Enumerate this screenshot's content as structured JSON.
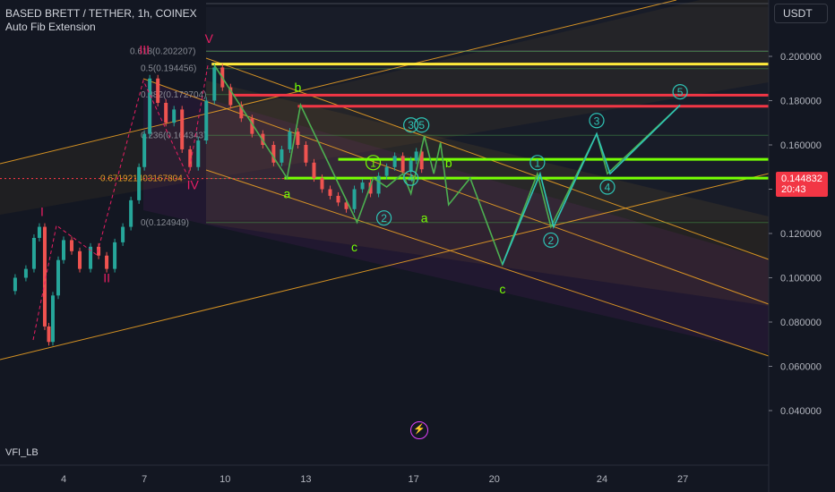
{
  "header": {
    "title": "BASED BRETT / TETHER, 1h, COINEX",
    "indicator": "Auto Fib Extension"
  },
  "currency": "USDT",
  "indicator_pane": {
    "label": "VFI_LB"
  },
  "last_price": {
    "value": "0.144832",
    "countdown": "20:43"
  },
  "colors": {
    "background": "#131722",
    "price_line": "#f23645",
    "candle_up": "#26a69a",
    "candle_down": "#ef5350",
    "channel": "#f5a623",
    "wave_green": "#4caf50",
    "wave_projection": "#2ec4b6",
    "fib_yellow": "#ffeb3b",
    "fib_red": "#f23645",
    "wave_pink": "#e91e63"
  },
  "chart_data": {
    "type": "line",
    "title": "BASED BRETT / TETHER, 1h, COINEX",
    "y_axis": {
      "ticks": [
        "0.200000",
        "0.180000",
        "0.160000",
        "0.140000",
        "0.120000",
        "0.100000",
        "0.080000",
        "0.060000",
        "0.040000"
      ],
      "range": [
        0.028,
        0.222
      ]
    },
    "x_axis": {
      "ticks": [
        "4",
        "7",
        "10",
        "13",
        "17",
        "20",
        "24",
        "27"
      ]
    },
    "price_series": [
      {
        "x": 1.8,
        "y": 0.094
      },
      {
        "x": 2.2,
        "y": 0.1
      },
      {
        "x": 2.6,
        "y": 0.104
      },
      {
        "x": 2.9,
        "y": 0.118
      },
      {
        "x": 3.1,
        "y": 0.123
      },
      {
        "x": 3.3,
        "y": 0.078
      },
      {
        "x": 3.45,
        "y": 0.071
      },
      {
        "x": 3.6,
        "y": 0.092
      },
      {
        "x": 3.8,
        "y": 0.108
      },
      {
        "x": 4.0,
        "y": 0.117
      },
      {
        "x": 4.3,
        "y": 0.112
      },
      {
        "x": 4.6,
        "y": 0.104
      },
      {
        "x": 5.0,
        "y": 0.114
      },
      {
        "x": 5.3,
        "y": 0.11
      },
      {
        "x": 5.6,
        "y": 0.104
      },
      {
        "x": 5.9,
        "y": 0.116
      },
      {
        "x": 6.2,
        "y": 0.123
      },
      {
        "x": 6.5,
        "y": 0.135
      },
      {
        "x": 6.8,
        "y": 0.15
      },
      {
        "x": 7.0,
        "y": 0.165
      },
      {
        "x": 7.2,
        "y": 0.19
      },
      {
        "x": 7.5,
        "y": 0.179
      },
      {
        "x": 7.8,
        "y": 0.17
      },
      {
        "x": 8.1,
        "y": 0.176
      },
      {
        "x": 8.4,
        "y": 0.158
      },
      {
        "x": 8.7,
        "y": 0.15
      },
      {
        "x": 9.0,
        "y": 0.162
      },
      {
        "x": 9.3,
        "y": 0.18
      },
      {
        "x": 9.6,
        "y": 0.195
      },
      {
        "x": 9.9,
        "y": 0.186
      },
      {
        "x": 10.2,
        "y": 0.178
      },
      {
        "x": 10.6,
        "y": 0.172
      },
      {
        "x": 11.0,
        "y": 0.165
      },
      {
        "x": 11.4,
        "y": 0.16
      },
      {
        "x": 11.8,
        "y": 0.152
      },
      {
        "x": 12.1,
        "y": 0.158
      },
      {
        "x": 12.4,
        "y": 0.166
      },
      {
        "x": 12.7,
        "y": 0.16
      },
      {
        "x": 13.0,
        "y": 0.152
      },
      {
        "x": 13.3,
        "y": 0.145
      },
      {
        "x": 13.6,
        "y": 0.14
      },
      {
        "x": 13.9,
        "y": 0.137
      },
      {
        "x": 14.2,
        "y": 0.134
      },
      {
        "x": 14.5,
        "y": 0.131
      },
      {
        "x": 14.8,
        "y": 0.14
      },
      {
        "x": 15.1,
        "y": 0.143
      },
      {
        "x": 15.4,
        "y": 0.138
      },
      {
        "x": 15.7,
        "y": 0.146
      },
      {
        "x": 16.0,
        "y": 0.15
      },
      {
        "x": 16.3,
        "y": 0.155
      },
      {
        "x": 16.6,
        "y": 0.148
      },
      {
        "x": 16.9,
        "y": 0.153
      },
      {
        "x": 17.1,
        "y": 0.157
      },
      {
        "x": 17.3,
        "y": 0.149
      }
    ],
    "series": [
      {
        "role": "primary_count",
        "points": [
          {
            "x": 9.6,
            "y": 0.196
          },
          {
            "x": 12.3,
            "y": 0.145
          },
          {
            "x": 12.8,
            "y": 0.178
          },
          {
            "x": 14.9,
            "y": 0.125
          },
          {
            "x": 15.5,
            "y": 0.145
          },
          {
            "x": 16.0,
            "y": 0.141
          },
          {
            "x": 16.6,
            "y": 0.147
          },
          {
            "x": 16.9,
            "y": 0.138
          },
          {
            "x": 17.4,
            "y": 0.164
          },
          {
            "x": 17.75,
            "y": 0.147
          },
          {
            "x": 18.0,
            "y": 0.161
          },
          {
            "x": 18.3,
            "y": 0.133
          },
          {
            "x": 19.1,
            "y": 0.145
          },
          {
            "x": 20.3,
            "y": 0.106
          },
          {
            "x": 21.6,
            "y": 0.147
          },
          {
            "x": 22.1,
            "y": 0.123
          },
          {
            "x": 23.8,
            "y": 0.165
          },
          {
            "x": 24.2,
            "y": 0.147
          },
          {
            "x": 26.9,
            "y": 0.178
          }
        ]
      },
      {
        "role": "projection",
        "points": [
          {
            "x": 20.3,
            "y": 0.106
          },
          {
            "x": 21.7,
            "y": 0.147
          },
          {
            "x": 22.2,
            "y": 0.123
          },
          {
            "x": 23.8,
            "y": 0.165
          },
          {
            "x": 24.3,
            "y": 0.147
          },
          {
            "x": 26.9,
            "y": 0.178
          }
        ]
      }
    ],
    "fib_levels": [
      {
        "label": "0.618(0.202207)",
        "y": 0.202207
      },
      {
        "label": "0.5(0.194456)",
        "y": 0.194456
      },
      {
        "label": "0.382(0.172704)",
        "y": 0.182704
      },
      {
        "label": "0.236(0.164343)",
        "y": 0.164343
      },
      {
        "label": "0.671921403167804(",
        "y": 0.14483
      },
      {
        "label": "0(0.124949)",
        "y": 0.124949
      }
    ],
    "horizontal_levels": [
      {
        "y": 0.1965,
        "color": "#ffeb3b",
        "x_from": 9.5
      },
      {
        "y": 0.1825,
        "color": "#f23645",
        "x_from": 10.3
      },
      {
        "y": 0.1775,
        "color": "#f23645",
        "x_from": 12.7
      },
      {
        "y": 0.1535,
        "color": "#76ff03",
        "x_from": 14.2
      },
      {
        "y": 0.145,
        "color": "#76ff03",
        "x_from": 12.2
      }
    ],
    "wave_labels": [
      {
        "text": "I",
        "x": 3.2,
        "y": 0.13,
        "color": "#e91e63"
      },
      {
        "text": "II",
        "x": 5.6,
        "y": 0.1,
        "color": "#e91e63"
      },
      {
        "text": "III",
        "x": 7.0,
        "y": 0.203,
        "color": "#e91e63"
      },
      {
        "text": "IV",
        "x": 8.8,
        "y": 0.142,
        "color": "#e91e63"
      },
      {
        "text": "V",
        "x": 9.4,
        "y": 0.208,
        "color": "#e91e63"
      },
      {
        "text": "a",
        "x": 12.3,
        "y": 0.138,
        "color": "#76ff03"
      },
      {
        "text": "b",
        "x": 12.7,
        "y": 0.186,
        "color": "#76ff03"
      },
      {
        "text": "c",
        "x": 14.8,
        "y": 0.114,
        "color": "#76ff03"
      },
      {
        "text": "1",
        "x": 15.5,
        "y": 0.152,
        "color": "#76ff03",
        "circled": true
      },
      {
        "text": "2",
        "x": 15.9,
        "y": 0.127,
        "color": "#2ec4b6",
        "circled": true
      },
      {
        "text": "3",
        "x": 16.9,
        "y": 0.169,
        "color": "#2ec4b6",
        "circled": true
      },
      {
        "text": "4",
        "x": 16.9,
        "y": 0.145,
        "color": "#2ec4b6",
        "circled": true
      },
      {
        "text": "5",
        "x": 17.3,
        "y": 0.169,
        "color": "#2ec4b6",
        "circled": true
      },
      {
        "text": "a",
        "x": 17.4,
        "y": 0.127,
        "color": "#76ff03"
      },
      {
        "text": "b",
        "x": 18.3,
        "y": 0.152,
        "color": "#76ff03"
      },
      {
        "text": "c",
        "x": 20.3,
        "y": 0.095,
        "color": "#76ff03"
      },
      {
        "text": "1",
        "x": 21.6,
        "y": 0.152,
        "color": "#2ec4b6",
        "circled": true
      },
      {
        "text": "2",
        "x": 22.1,
        "y": 0.117,
        "color": "#2ec4b6",
        "circled": true
      },
      {
        "text": "3",
        "x": 23.8,
        "y": 0.171,
        "color": "#2ec4b6",
        "circled": true
      },
      {
        "text": "4",
        "x": 24.2,
        "y": 0.141,
        "color": "#2ec4b6",
        "circled": true
      },
      {
        "text": "5",
        "x": 26.9,
        "y": 0.184,
        "color": "#2ec4b6",
        "circled": true
      }
    ],
    "grid": false
  }
}
